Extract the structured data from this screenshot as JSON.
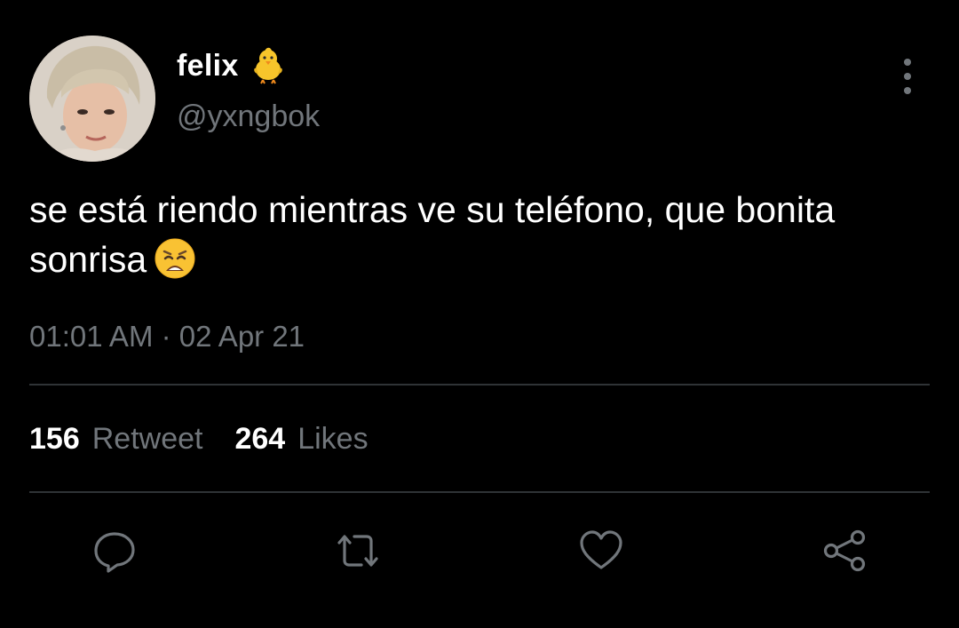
{
  "user": {
    "display_name": "felix",
    "handle": "@yxngbok",
    "name_emoji": "chick-icon"
  },
  "tweet": {
    "text": "se está riendo mientras ve su teléfono, que bonita sonrisa",
    "text_emoji": "weary-face-icon",
    "timestamp": "01:01 AM · 02 Apr 21"
  },
  "stats": {
    "retweets_count": "156",
    "retweets_label": "Retweet",
    "likes_count": "264",
    "likes_label": "Likes"
  },
  "actions": {
    "icons": [
      "reply-icon",
      "retweet-icon",
      "like-icon",
      "share-icon"
    ]
  },
  "colors": {
    "background": "#000000",
    "primary_text": "#ffffff",
    "secondary_text": "#71767b",
    "divider": "#2f3336"
  }
}
